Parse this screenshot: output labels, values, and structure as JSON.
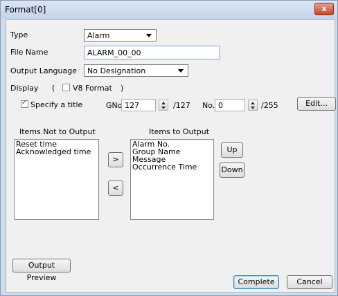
{
  "window": {
    "title": "Format[0]",
    "close_glyph": "x"
  },
  "type_field": {
    "label": "Type",
    "value": "Alarm"
  },
  "file_name_field": {
    "label": "File Name",
    "value": "ALARM_00_00"
  },
  "output_language_field": {
    "label": "Output Language",
    "value": "No Designation"
  },
  "display_group": {
    "label": "Display",
    "open_paren": "(",
    "close_paren": ")",
    "v8_format": {
      "label": "V8 Format",
      "checked": false
    }
  },
  "title_group": {
    "specify_title": {
      "label": "Specify a title",
      "checked": true
    },
    "gno_label": "GNo.",
    "gno_value": "127",
    "gno_max": "/127",
    "no_label": "No.",
    "no_value": "0",
    "no_max": "/255",
    "edit_button": "Edit..."
  },
  "items_not_output": {
    "header": "Items Not to Output",
    "items": [
      "Reset time",
      "Acknowledged time"
    ]
  },
  "items_output": {
    "header": "Items to Output",
    "items": [
      "Alarm No.",
      "Group Name",
      "Message",
      "Occurrence Time"
    ]
  },
  "move_right_button": ">",
  "move_left_button": "<",
  "up_button": "Up",
  "down_button": "Down",
  "output_preview_button": "Output Preview",
  "complete_button": "Complete",
  "cancel_button": "Cancel",
  "colors": {
    "title_bar": "#c4d5ea",
    "close_button": "#c8432a",
    "dialog_bg": "#f0f0f0"
  },
  "icons": {
    "close": "close-icon",
    "combo_arrow": "chevron-down-icon",
    "spin": "spin-updown-icon"
  }
}
